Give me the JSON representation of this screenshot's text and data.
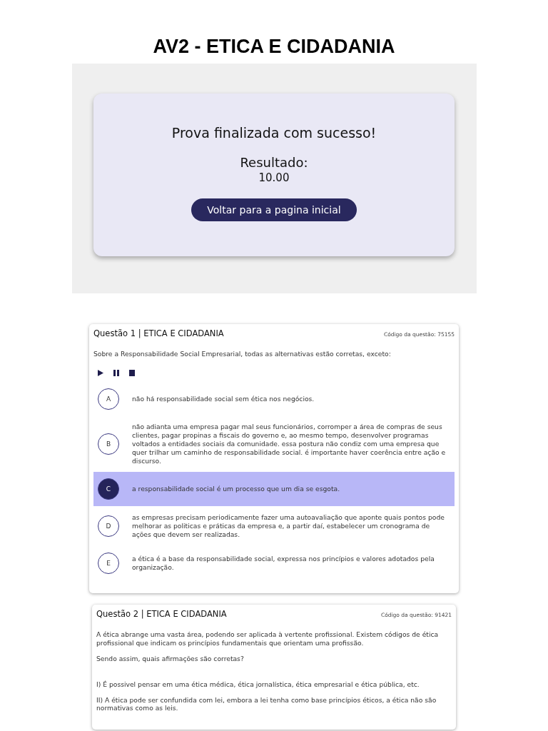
{
  "page_title": "AV2 - ETICA E CIDADANIA",
  "result_panel": {
    "message": "Prova finalizada com sucesso!",
    "result_label": "Resultado:",
    "score": "10.00",
    "button": "Voltar para a pagina inicial"
  },
  "questions": [
    {
      "title": "Questão 1 | ETICA E CIDADANIA",
      "code": "Código da questão: 75155",
      "paragraphs": [
        "Sobre a Responsabilidade Social Empresarial, todas as alternativas estão corretas, exceto:"
      ],
      "audio_controls": true,
      "options": [
        {
          "letter": "A",
          "text": "não há responsabilidade social sem ética nos negócios.",
          "selected": false
        },
        {
          "letter": "B",
          "text": "não adianta uma empresa pagar mal seus funcionários, corromper a área de compras de seus clientes, pagar propinas a fiscais do governo e, ao mesmo tempo, desenvolver programas voltados a entidades sociais da comunidade. essa postura não condiz com uma empresa que quer trilhar um caminho de responsabilidade social. é importante haver coerência entre ação e discurso.",
          "selected": false
        },
        {
          "letter": "C",
          "text": "a responsabilidade social é um processo que um dia se esgota.",
          "selected": true
        },
        {
          "letter": "D",
          "text": "as empresas precisam periodicamente fazer uma autoavaliação que aponte quais pontos pode melhorar as politicas e práticas da empresa e, a partir daí, estabelecer um cronograma de ações que devem ser realizadas.",
          "selected": false
        },
        {
          "letter": "E",
          "text": "a ética é a base da responsabilidade social, expressa nos princípios e valores adotados pela organização.",
          "selected": false
        }
      ]
    },
    {
      "title": "Questão 2 | ETICA E CIDADANIA",
      "code": "Código da questão: 91421",
      "paragraphs": [
        "A ética abrange uma vasta área, podendo ser aplicada à vertente profissional. Existem códigos de ética profissional que indicam os princípios fundamentais que orientam uma profissão.",
        "Sendo assim, quais afirmações são corretas?",
        "I) É possivel pensar em uma ética médica, ética jornalística, ética empresarial e ética pública, etc.",
        "II) A ética pode ser confundida com lei, embora a lei tenha como base princípios éticos, a ética não são normativas como as leis."
      ],
      "audio_controls": false
    }
  ]
}
